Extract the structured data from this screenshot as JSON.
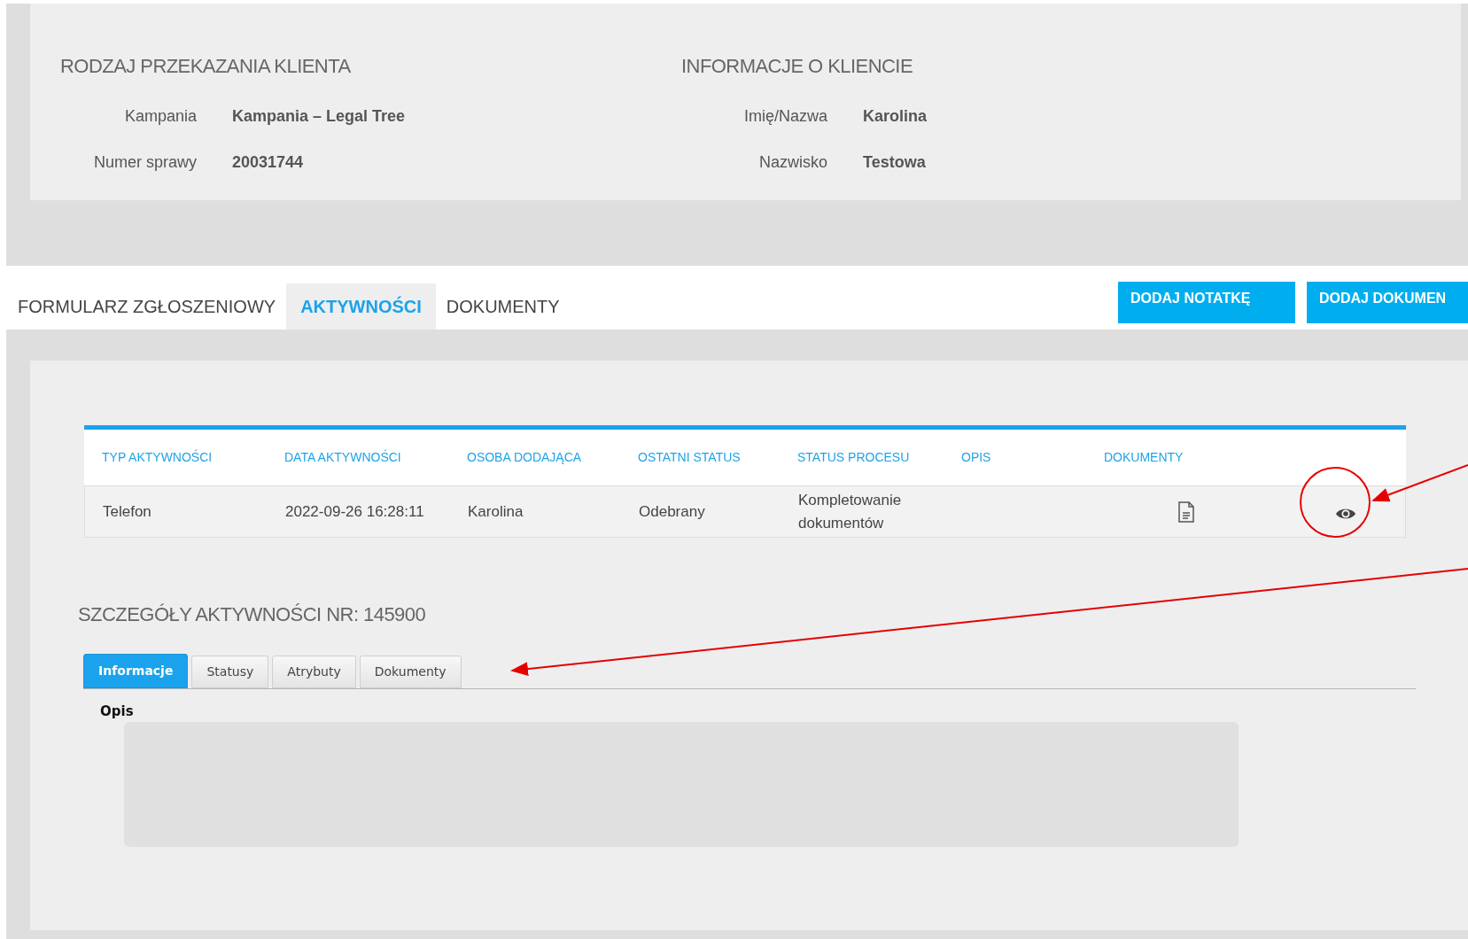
{
  "client_transfer": {
    "heading": "RODZAJ PRZEKAZANIA KLIENTA",
    "fields": [
      {
        "label": "Kampania",
        "value": "Kampania – Legal Tree"
      },
      {
        "label": "Numer sprawy",
        "value": "20031744"
      }
    ]
  },
  "client_info": {
    "heading": "INFORMACJE O KLIENCIE",
    "fields": [
      {
        "label": "Imię/Nazwa",
        "value": "Karolina"
      },
      {
        "label": "Nazwisko",
        "value": "Testowa"
      }
    ]
  },
  "main_tabs": [
    {
      "label": "FORMULARZ ZGŁOSZENIOWY",
      "selected": false
    },
    {
      "label": "AKTYWNOŚCI",
      "selected": true
    },
    {
      "label": "DOKUMENTY",
      "selected": false
    }
  ],
  "buttons": [
    "DODAJ NOTATKĘ",
    "DODAJ DOKUMEN"
  ],
  "activities_table": {
    "columns": [
      "TYP AKTYWNOŚCI",
      "DATA AKTYWNOŚCI",
      "OSOBA DODAJĄCA",
      "OSTATNI STATUS",
      "STATUS PROCESU",
      "OPIS",
      "DOKUMENTY"
    ],
    "rows": [
      {
        "cells": [
          "Telefon",
          "2022-09-26 16:28:11",
          "Karolina",
          "Odebrany",
          "Kompletowanie dokumentów"
        ]
      }
    ]
  },
  "details": {
    "heading": "SZCZEGÓŁY AKTYWNOŚCI NR: 145900",
    "tabs": [
      {
        "label": "Informacje",
        "selected": true
      },
      {
        "label": "Statusy",
        "selected": false
      },
      {
        "label": "Atrybuty",
        "selected": false
      },
      {
        "label": "Dokumenty",
        "selected": false
      }
    ],
    "field_label": "Opis"
  }
}
